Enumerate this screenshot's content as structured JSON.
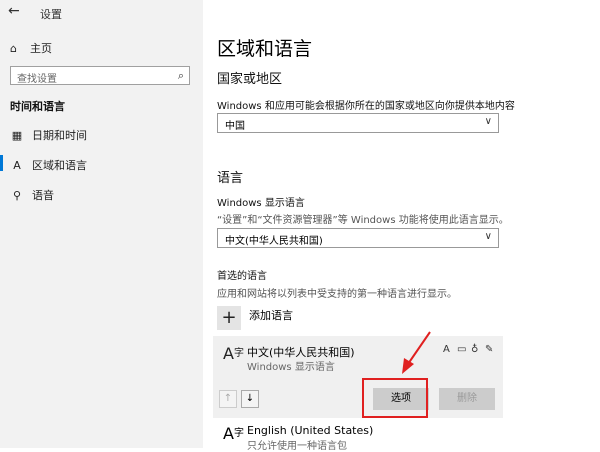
{
  "window": {
    "title": "设置"
  },
  "sidebar": {
    "home_label": "主页",
    "search_placeholder": "查找设置",
    "section_title": "时间和语言",
    "items": [
      {
        "label": "日期和时间",
        "icon": "calendar-icon"
      },
      {
        "label": "区域和语言",
        "icon": "region-language-icon"
      },
      {
        "label": "语音",
        "icon": "microphone-icon"
      }
    ]
  },
  "main": {
    "title": "区域和语言",
    "region": {
      "heading": "国家或地区",
      "description": "Windows 和应用可能会根据你所在的国家或地区向你提供本地内容",
      "selected": "中国"
    },
    "language": {
      "heading": "语言",
      "display_label": "Windows 显示语言",
      "display_description": "“设置”和“文件资源管理器”等 Windows 功能将使用此语言显示。",
      "display_selected": "中文(中华人民共和国)",
      "preferred_label": "首选的语言",
      "preferred_description": "应用和网站将以列表中受支持的第一种语言进行显示。",
      "add_label": "添加语言",
      "items": [
        {
          "name": "中文(中华人民共和国)",
          "sub": "Windows 显示语言"
        },
        {
          "name": "English (United States)",
          "sub": "只允许使用一种语言包"
        }
      ],
      "options_label": "选项",
      "remove_label": "删除"
    }
  },
  "colors": {
    "accent": "#0078d7",
    "annotation": "#e02020"
  }
}
